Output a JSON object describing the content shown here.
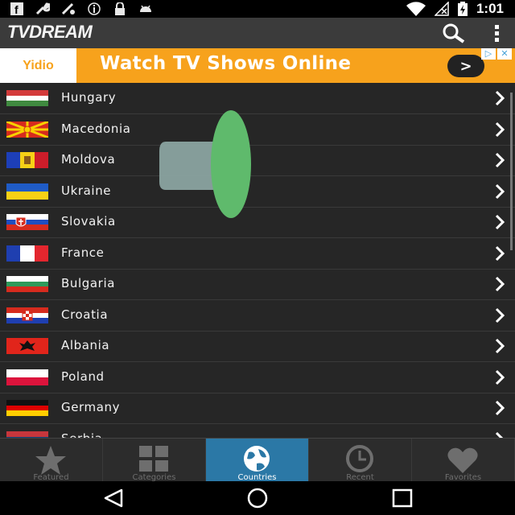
{
  "status_bar": {
    "time": "1:01",
    "icons": [
      "facebook-icon",
      "wrench-icon",
      "fave-icon",
      "info-icon",
      "lock-icon",
      "android-icon"
    ],
    "right_icons": [
      "wifi-icon",
      "no-signal-icon",
      "battery-charging-icon"
    ]
  },
  "app_bar": {
    "title": "TVDREAM",
    "actions": [
      "search-icon",
      "overflow-menu-icon"
    ]
  },
  "ad": {
    "brand": "Yidio",
    "text": "Watch TV Shows Online",
    "button": ">",
    "brand_color": "#f7a21c"
  },
  "countries": [
    {
      "name": "Hungary"
    },
    {
      "name": "Macedonia"
    },
    {
      "name": "Moldova"
    },
    {
      "name": "Ukraine"
    },
    {
      "name": "Slovakia"
    },
    {
      "name": "France"
    },
    {
      "name": "Bulgaria"
    },
    {
      "name": "Croatia"
    },
    {
      "name": "Albania"
    },
    {
      "name": "Poland"
    },
    {
      "name": "Germany"
    },
    {
      "name": "Serbia"
    }
  ],
  "tabs": [
    {
      "label": "Featured",
      "icon": "star-icon",
      "active": false
    },
    {
      "label": "Categories",
      "icon": "grid-icon",
      "active": false
    },
    {
      "label": "Countries",
      "icon": "globe-icon",
      "active": true
    },
    {
      "label": "Recent",
      "icon": "clock-icon",
      "active": false
    },
    {
      "label": "Favorites",
      "icon": "heart-icon",
      "active": false
    }
  ],
  "nav_bar": {
    "buttons": [
      "back-icon",
      "home-icon",
      "recents-icon"
    ]
  },
  "colors": {
    "accent": "#2b78a6",
    "ad_background": "#f7a21c",
    "list_background": "#262626"
  }
}
